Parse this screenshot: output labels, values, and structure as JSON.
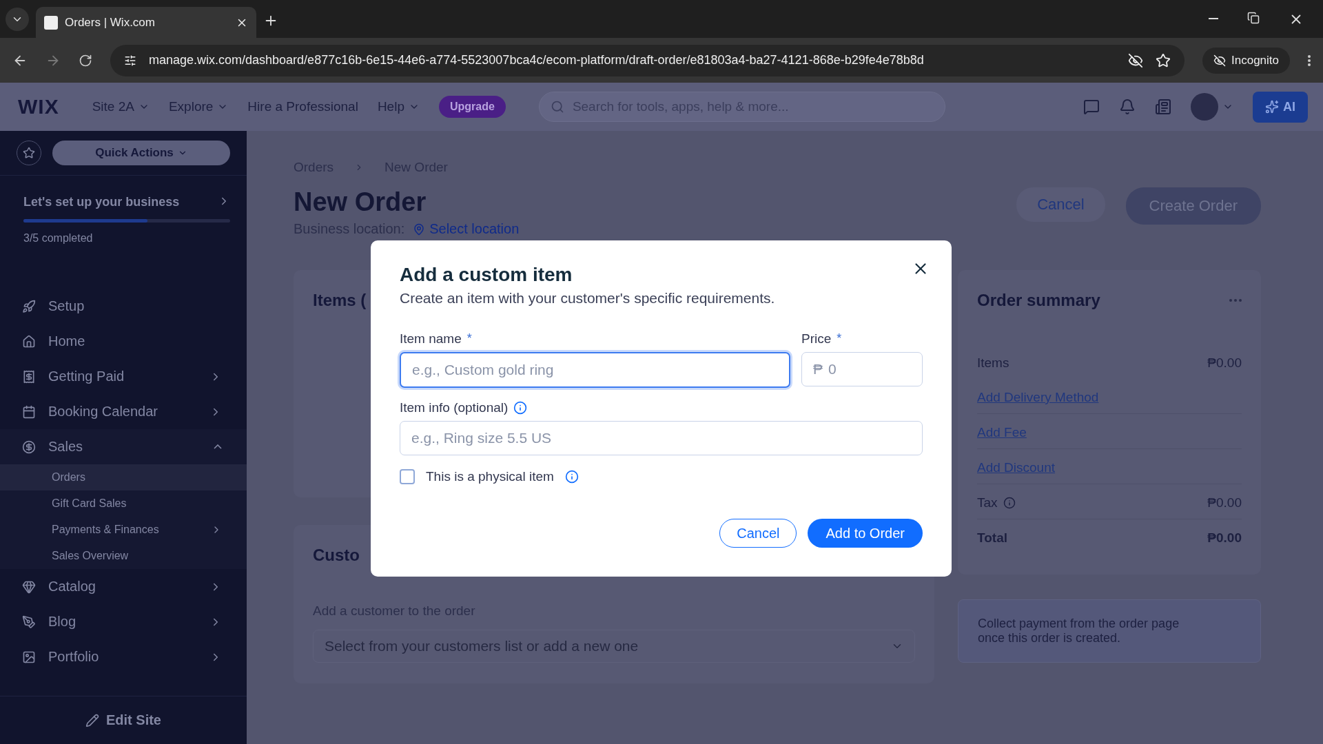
{
  "browser": {
    "tab_title": "Orders | Wix.com",
    "url": "manage.wix.com/dashboard/e877c16b-6e15-44e6-a774-5523007bca4c/ecom-platform/draft-order/e81803a4-ba27-4121-868e-b29fe4e78b8d",
    "incognito_label": "Incognito"
  },
  "topbar": {
    "logo": "WIX",
    "menus": [
      {
        "label": "Site 2A",
        "dropdown": true
      },
      {
        "label": "Explore",
        "dropdown": true
      },
      {
        "label": "Hire a Professional",
        "dropdown": false
      },
      {
        "label": "Help",
        "dropdown": true
      }
    ],
    "upgrade": "Upgrade",
    "search": {
      "placeholder": "Search for tools, apps, help & more..."
    },
    "ai_button": "AI"
  },
  "sidebar": {
    "quick_actions": "Quick Actions",
    "setup": {
      "title": "Let's set up your business",
      "level": 0.6,
      "progress_text": "3/5 completed"
    },
    "items": [
      {
        "label": "Setup",
        "has_arrow": false
      },
      {
        "label": "Home",
        "has_arrow": false
      },
      {
        "label": "Getting Paid",
        "has_arrow": true,
        "expanded": false
      },
      {
        "label": "Booking Calendar",
        "has_arrow": true,
        "expanded": false
      },
      {
        "label": "Sales",
        "has_arrow": true,
        "expanded": true,
        "children": [
          {
            "label": "Orders",
            "selected": true,
            "has_arrow": false
          },
          {
            "label": "Gift Card Sales",
            "selected": false,
            "has_arrow": false
          },
          {
            "label": "Payments & Finances",
            "selected": false,
            "has_arrow": true
          },
          {
            "label": "Sales Overview",
            "selected": false,
            "has_arrow": false
          }
        ]
      },
      {
        "label": "Catalog",
        "has_arrow": true,
        "expanded": false
      },
      {
        "label": "Blog",
        "has_arrow": true,
        "expanded": false
      },
      {
        "label": "Portfolio",
        "has_arrow": true,
        "expanded": false
      }
    ],
    "edit_site": "Edit Site"
  },
  "page": {
    "breadcrumbs": [
      "Orders",
      "New Order"
    ],
    "title": "New Order",
    "location_label": "Business location:",
    "location_link": "Select location",
    "cancel": "Cancel",
    "create_order": "Create Order",
    "items_heading": "Items (",
    "customer_heading": "Custo",
    "customer_label": "Add a customer to the order",
    "customer_select": {
      "placeholder": "Select from your customers list or add a new one"
    }
  },
  "summary": {
    "title": "Order summary",
    "rows": [
      {
        "kind": "value",
        "label": "Items",
        "value": "₱0.00"
      },
      {
        "kind": "link",
        "label": "Add Delivery Method"
      },
      {
        "kind": "link",
        "label": "Add Fee"
      },
      {
        "kind": "link",
        "label": "Add Discount"
      },
      {
        "kind": "info",
        "label": "Tax",
        "value": "₱0.00"
      },
      {
        "kind": "total",
        "label": "Total",
        "value": "₱0.00"
      }
    ],
    "note": "Collect payment from the order page once this order is created."
  },
  "dialog": {
    "title": "Add a custom item",
    "subtitle": "Create an item with your customer's specific requirements.",
    "name_label": "Item name",
    "name_required": "*",
    "price_required": "*",
    "name_field": {
      "placeholder": "e.g., Custom gold ring",
      "focused": true
    },
    "price_label": "Price",
    "price_field": {
      "currency": "₱",
      "placeholder": "0"
    },
    "info_label": "Item info (optional)",
    "info_field": {
      "placeholder": "e.g., Ring size 5.5 US"
    },
    "physical": {
      "label": "This is a physical item",
      "checked": false
    },
    "cancel": "Cancel",
    "submit": "Add to Order"
  }
}
